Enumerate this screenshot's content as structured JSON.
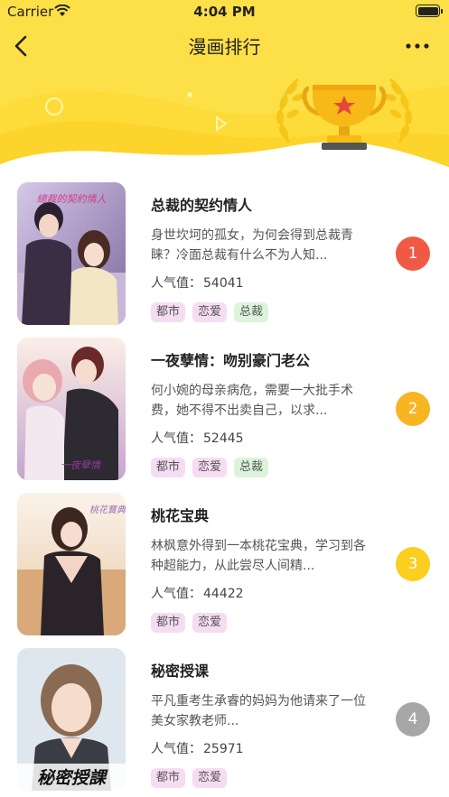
{
  "status_bar": {
    "carrier": "Carrier",
    "time": "4:04 PM"
  },
  "nav": {
    "title": "漫画排行"
  },
  "colors": {
    "header_yellow": "#fde047",
    "rank1": "#f05a44",
    "rank2": "#f7b521",
    "rank3": "#fbce1f",
    "rank4": "#a7a7a7"
  },
  "items": [
    {
      "title": "总裁的契约情人",
      "desc": "身世坎坷的孤女，为何会得到总裁青睐？冷面总裁有什么不为人知...",
      "pop_label": "人气值：",
      "pop_value": "54041",
      "tags": [
        "都市",
        "恋爱",
        "总裁"
      ],
      "rank": "1"
    },
    {
      "title": "一夜孽情：吻别豪门老公",
      "desc": "何小婉的母亲病危，需要一大批手术费，她不得不出卖自己，以求...",
      "pop_label": "人气值：",
      "pop_value": "52445",
      "tags": [
        "都市",
        "恋爱",
        "总裁"
      ],
      "rank": "2"
    },
    {
      "title": "桃花宝典",
      "desc": "林枫意外得到一本桃花宝典，学习到各种超能力，从此尝尽人间精...",
      "pop_label": "人气值：",
      "pop_value": "44422",
      "tags": [
        "都市",
        "恋爱"
      ],
      "rank": "3"
    },
    {
      "title": "秘密授课",
      "desc": "平凡重考生承睿的妈妈为他请来了一位美女家教老师...",
      "pop_label": "人气值：",
      "pop_value": "25971",
      "tags": [
        "都市",
        "恋爱"
      ],
      "rank": "4"
    }
  ],
  "covers": [
    {
      "logo_text": "總裁的契約情人"
    },
    {
      "logo_text": "一夜孽情"
    },
    {
      "logo_text": "桃花寶典"
    },
    {
      "logo_text": "秘密授課"
    }
  ]
}
